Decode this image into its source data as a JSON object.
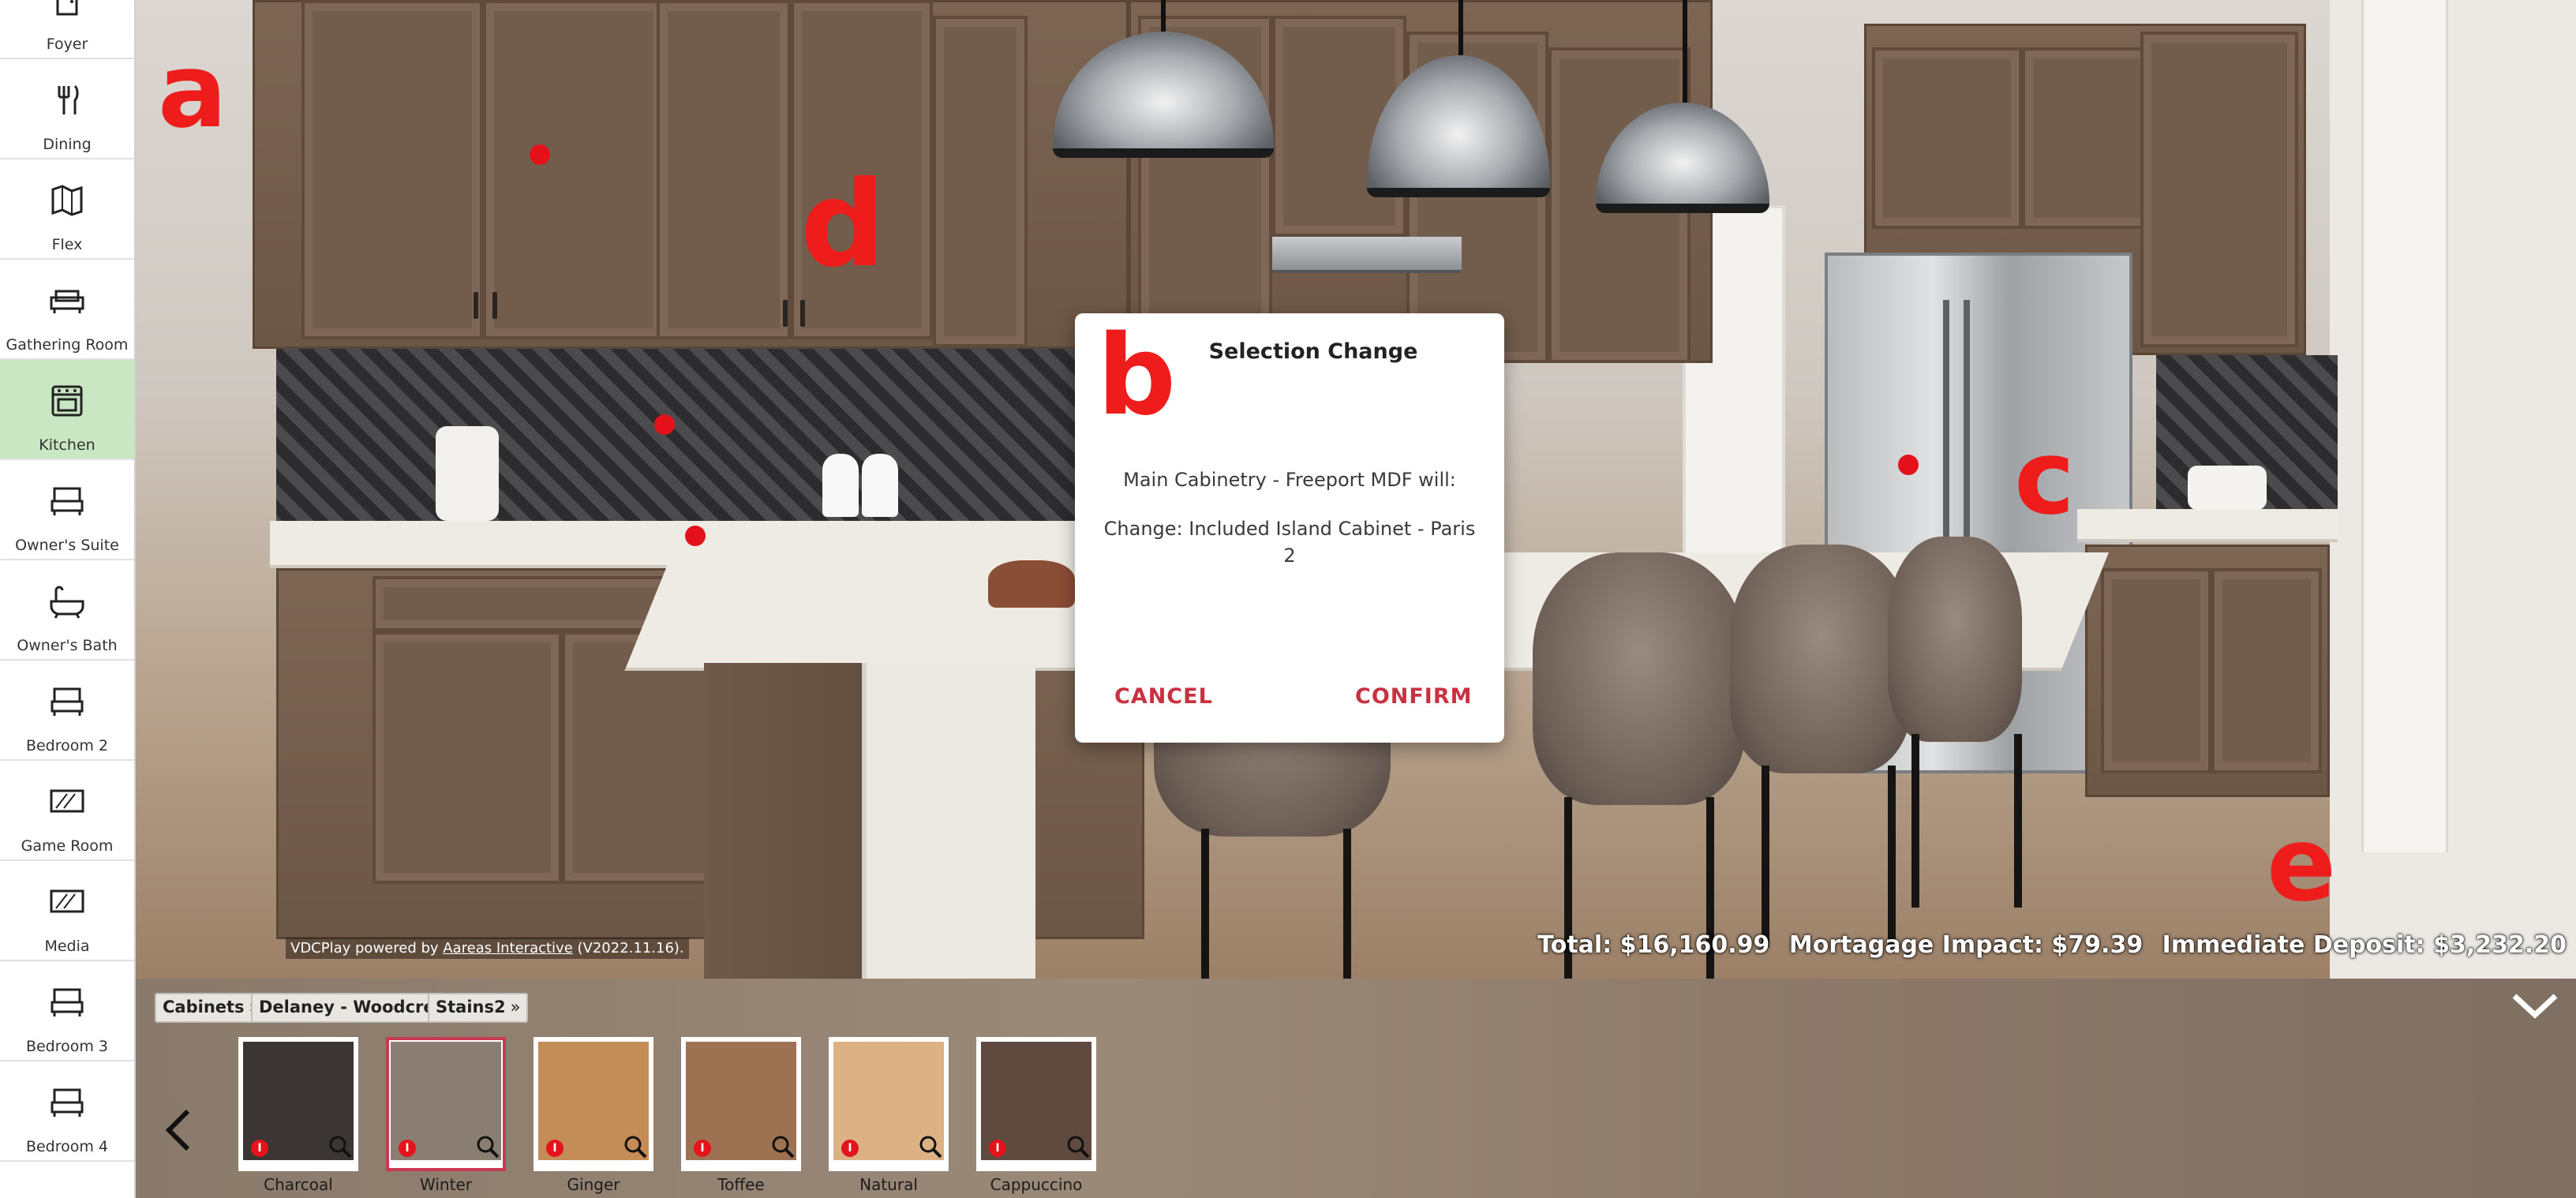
{
  "sidebar": {
    "items": [
      {
        "label": "Foyer",
        "icon": "door-icon"
      },
      {
        "label": "Dining",
        "icon": "fork-knife-icon"
      },
      {
        "label": "Flex",
        "icon": "map-icon"
      },
      {
        "label": "Gathering Room",
        "icon": "sofa-icon"
      },
      {
        "label": "Kitchen",
        "icon": "stove-icon",
        "active": true
      },
      {
        "label": "Owner's Suite",
        "icon": "bed-icon"
      },
      {
        "label": "Owner's Bath",
        "icon": "bathtub-icon"
      },
      {
        "label": "Bedroom 2",
        "icon": "bed-icon"
      },
      {
        "label": "Game Room",
        "icon": "tv-icon"
      },
      {
        "label": "Media",
        "icon": "tv-icon"
      },
      {
        "label": "Bedroom 3",
        "icon": "bed-icon"
      },
      {
        "label": "Bedroom 4",
        "icon": "bed-icon"
      }
    ]
  },
  "annotations": {
    "a": "a",
    "b": "b",
    "c": "c",
    "d": "d",
    "e": "e"
  },
  "dialog": {
    "title": "Selection Change",
    "line1": "Main Cabinetry - Freeport MDF will:",
    "line2": "Change: Included Island Cabinet - Paris 2",
    "cancel": "CANCEL",
    "confirm": "CONFIRM"
  },
  "footer": {
    "powered_prefix": "VDCPlay powered by ",
    "powered_link": "Aareas Interactive",
    "powered_version": " (V2022.11.16)."
  },
  "totals": {
    "total": "Total: $16,160.99",
    "mortgage": "Mortagage Impact: $79.39",
    "deposit": "Immediate Deposit: $3,232.20"
  },
  "breadcrumbs": [
    "Cabinets",
    "Delaney - Woodcrest",
    "Stains2"
  ],
  "swatches": [
    {
      "name": "Charcoal",
      "color": "#3b3533",
      "selected": false
    },
    {
      "name": "Winter",
      "color": "#8a7d72",
      "selected": true
    },
    {
      "name": "Ginger",
      "color": "#c48c56",
      "selected": false
    },
    {
      "name": "Toffee",
      "color": "#9d7252",
      "selected": false
    },
    {
      "name": "Natural",
      "color": "#dcb285",
      "selected": false
    },
    {
      "name": "Cappuccino",
      "color": "#5e4a3e",
      "selected": false
    }
  ],
  "info_badge": "I",
  "colors": {
    "accent": "#c8313f",
    "active_room": "#c9e7c3",
    "annotation": "#ef1c1c"
  }
}
